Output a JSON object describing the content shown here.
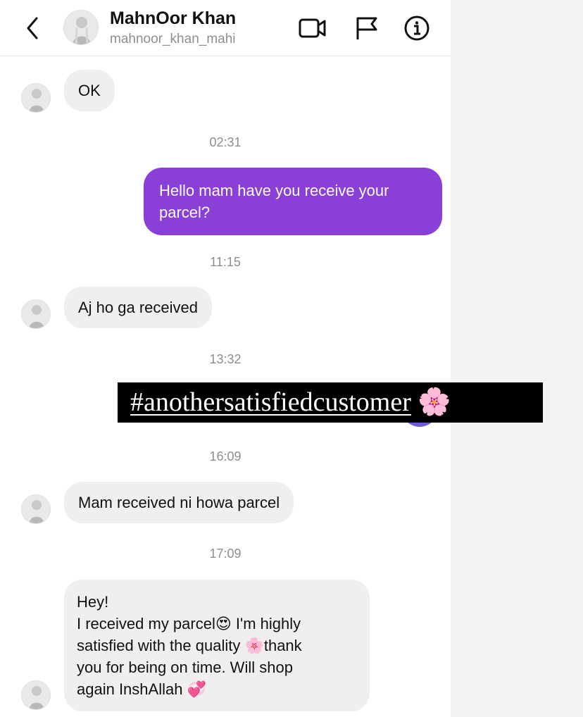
{
  "header": {
    "name": "MahnOor Khan",
    "handle": "mahnoor_khan_mahi"
  },
  "icons": {
    "back": "chevron-left-icon",
    "video": "video-camera-icon",
    "flag": "flag-icon",
    "info": "info-icon"
  },
  "messages": [
    {
      "from": "them",
      "text": "OK"
    },
    {
      "time": "02:31"
    },
    {
      "from": "me",
      "text": "Hello mam have you receive your parcel?"
    },
    {
      "time": "11:15"
    },
    {
      "from": "them",
      "text": "Aj ho ga received"
    },
    {
      "time": "13:32"
    },
    {
      "sticker": "#anothersatisfiedcustomer",
      "emoji": "🌸"
    },
    {
      "time": "16:09"
    },
    {
      "from": "them",
      "text": "Mam received ni howa parcel"
    },
    {
      "time": "17:09"
    },
    {
      "from": "them",
      "lines": [
        "Hey!",
        "I received my parcel😍 I'm highly",
        "satisfied with the quality 🌸thank",
        "you for being on time. Will shop",
        "again InshAllah 💞"
      ]
    }
  ],
  "colors": {
    "outgoing_bubble": "#8a3fd7",
    "incoming_bubble": "#efefef",
    "timestamp": "#8e8e8e"
  }
}
